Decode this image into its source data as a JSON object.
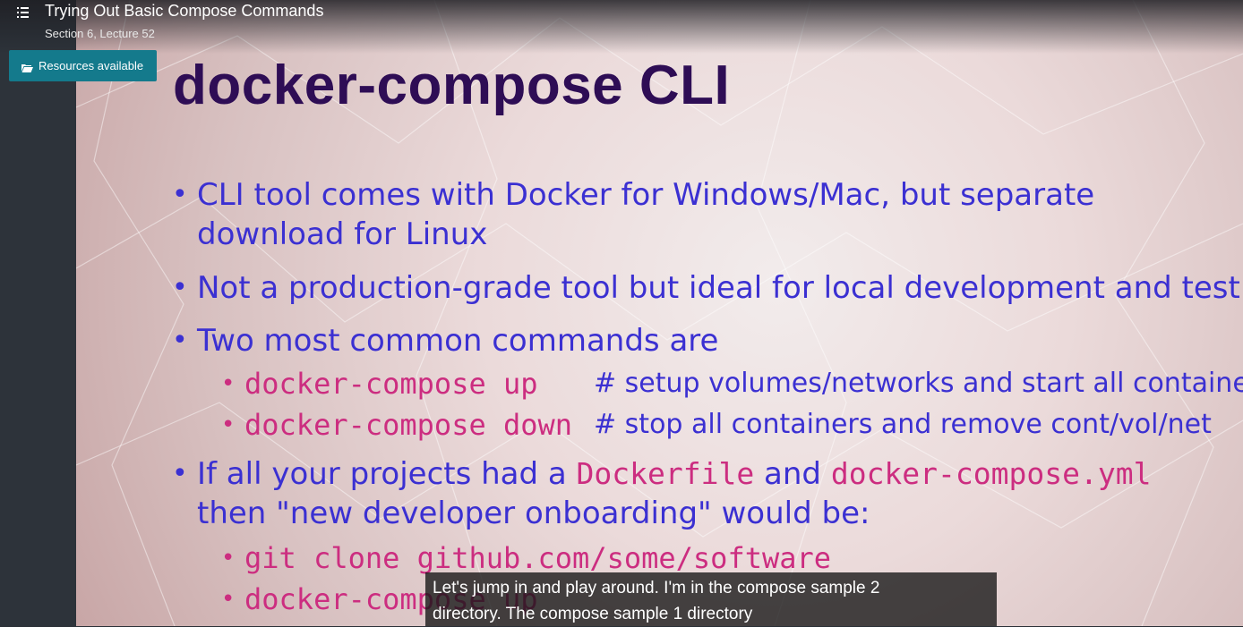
{
  "header": {
    "title": "Trying Out Basic Compose Commands",
    "subtitle": "Section 6, Lecture 52",
    "menu_icon": "list-icon"
  },
  "resources_button": {
    "label": "Resources available",
    "icon": "folder-open-icon"
  },
  "slide": {
    "title": "docker-compose CLI",
    "bullets": [
      {
        "line1": "CLI tool comes with Docker for Windows/Mac, but separate",
        "line2": "download for Linux"
      },
      {
        "line1": "Not a production-grade tool but ideal for local development and test"
      },
      {
        "line1": "Two most common commands are"
      }
    ],
    "commands": [
      {
        "cmd": "docker-compose up",
        "comment": "# setup volumes/networks and start all containers"
      },
      {
        "cmd": "docker-compose down",
        "comment": "# stop all containers and remove cont/vol/net"
      }
    ],
    "bullet4": {
      "prefix": "If all your projects had a",
      "code1": "Dockerfile",
      "middle": "and",
      "code2": "docker-compose.yml",
      "line2": "then \"new developer onboarding\" would be:"
    },
    "onboarding_steps": [
      "git clone github.com/some/software",
      "docker-compose up"
    ]
  },
  "caption": {
    "line1": "Let's jump in and play around. I'm in the compose sample 2",
    "line2": "directory. The compose sample 1 directory"
  },
  "colors": {
    "title": "#2e0d55",
    "bullet_text": "#3b30d2",
    "code": "#cc2d80",
    "resources_bg": "#147a8c",
    "sidebar_bg": "#2d333a"
  }
}
